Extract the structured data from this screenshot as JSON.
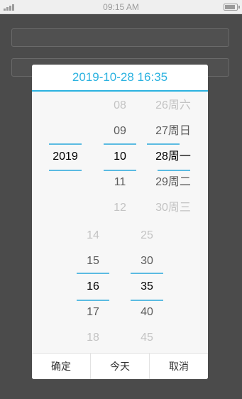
{
  "status_bar": {
    "time": "09:15 AM"
  },
  "picker": {
    "header": "2019-10-28 16:35",
    "year": {
      "selected": "2019"
    },
    "month": {
      "options": [
        "08",
        "09",
        "10",
        "11",
        "12"
      ]
    },
    "day": {
      "options": [
        "26周六",
        "27周日",
        "28周一",
        "29周二",
        "30周三"
      ]
    },
    "hour": {
      "options": [
        "14",
        "15",
        "16",
        "17",
        "18"
      ]
    },
    "minute": {
      "options": [
        "25",
        "30",
        "35",
        "40",
        "45"
      ]
    },
    "buttons": {
      "confirm": "确定",
      "today": "今天",
      "cancel": "取消"
    }
  },
  "colors": {
    "accent": "#2bb2e0",
    "overlay": "#4b4b4b"
  }
}
